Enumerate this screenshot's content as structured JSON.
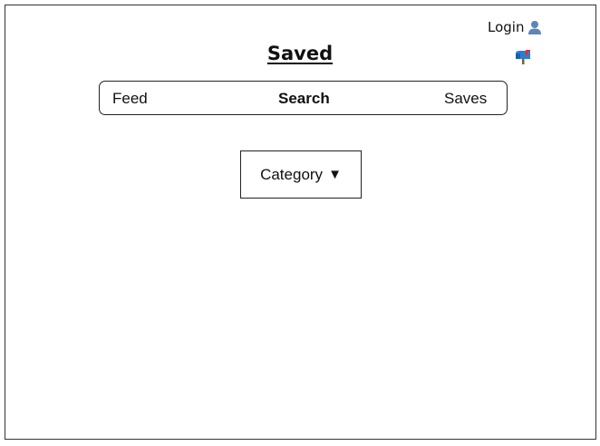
{
  "header": {
    "login_label": "Login",
    "user_icon": "user-icon",
    "mailbox_icon": "mailbox-icon"
  },
  "page": {
    "title": "Saved"
  },
  "nav": {
    "items": [
      {
        "label": "Feed",
        "active": false
      },
      {
        "label": "Search",
        "active": true
      },
      {
        "label": "Saves",
        "active": false
      }
    ]
  },
  "filter": {
    "category_label": "Category",
    "caret": "▼"
  },
  "colors": {
    "border": "#222222",
    "text": "#111111",
    "user_icon": "#5b86b8",
    "mailbox_blue": "#2a7fd4",
    "mailbox_red": "#d8333a"
  }
}
